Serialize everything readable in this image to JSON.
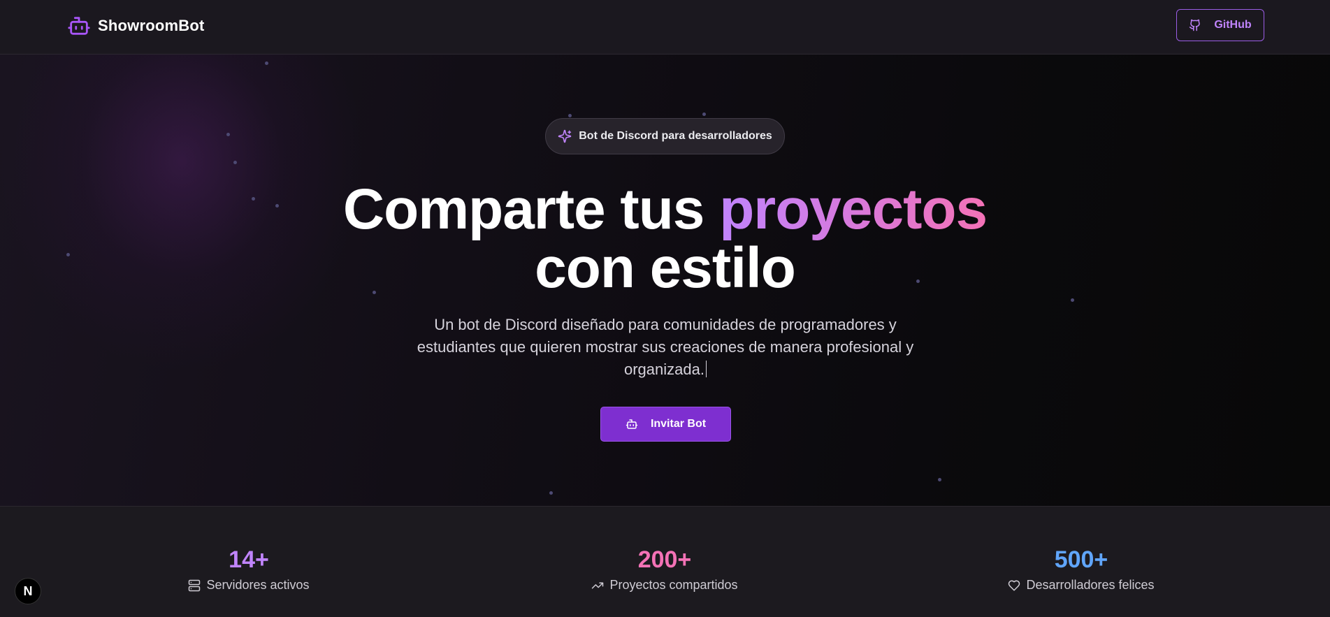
{
  "nav": {
    "brand": "ShowroomBot",
    "github_label": "GitHub"
  },
  "hero": {
    "badge": "Bot de Discord para desarrolladores",
    "headline_part1": "Comparte tus ",
    "headline_accent": "proyectos",
    "headline_part2": "con estilo",
    "subtitle": "Un bot de Discord diseñado para comunidades de programadores y estudiantes que quieren mostrar sus creaciones de manera profesional y organizada.",
    "cta_label": "Invitar Bot"
  },
  "stats": [
    {
      "value": "14+",
      "label": "Servidores activos",
      "icon": "server-icon",
      "color": "#c084fc"
    },
    {
      "value": "200+",
      "label": "Proyectos compartidos",
      "icon": "trending-up-icon",
      "color": "#f472b6"
    },
    {
      "value": "500+",
      "label": "Desarrolladores felices",
      "icon": "heart-icon",
      "color": "#60a5fa"
    }
  ],
  "dev_badge": "N",
  "colors": {
    "accent": "#7e2fd0",
    "purple": "#c084fc",
    "pink": "#f472b6",
    "blue": "#60a5fa"
  }
}
